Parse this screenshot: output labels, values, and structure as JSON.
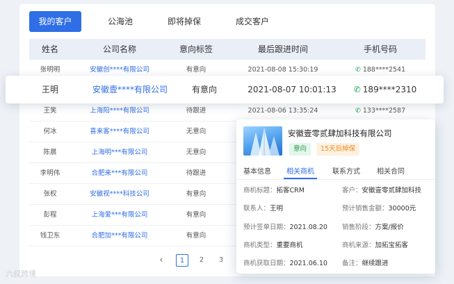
{
  "tabs": [
    "我的客户",
    "公海池",
    "即将掉保",
    "成交客户"
  ],
  "columns": [
    "姓名",
    "公司名称",
    "意向标签",
    "最后跟进时间",
    "手机号码"
  ],
  "rows": [
    {
      "name": "张明明",
      "company": "安徽创****有限公司",
      "tag": "有意向",
      "time": "2021-08-08  15:30:19",
      "phone": "188****2541"
    },
    {
      "name": "王明",
      "company": "安徽壹****有限公司",
      "tag": "有意向",
      "time": "2021-08-07  10:01:13",
      "phone": "189****2310"
    },
    {
      "name": "王笑",
      "company": "上海阳****有限公司",
      "tag": "待跟进",
      "time": "2021-08-06  13:35:24",
      "phone": "133****2587"
    },
    {
      "name": "何冰",
      "company": "喜来客****有限公司",
      "tag": "无意向"
    },
    {
      "name": "陈晨",
      "company": "上海明***有限公司",
      "tag": "无意向"
    },
    {
      "name": "李明伟",
      "company": "合肥来***有限公司",
      "tag": "待跟进"
    },
    {
      "name": "张权",
      "company": "安徽视****科技公司",
      "tag": "有意向"
    },
    {
      "name": "彭程",
      "company": "上海爱***有限公司",
      "tag": "有意向"
    },
    {
      "name": "钱卫东",
      "company": "合肥加***有限公司",
      "tag": "有意向"
    }
  ],
  "pagination": {
    "pages": [
      "1",
      "2",
      "3"
    ],
    "current": "1",
    "prev": "‹"
  },
  "icons": {
    "phone": "phone-icon",
    "prev": "chevron-left-icon"
  },
  "popup": {
    "company": "安徽壹零贰肆加科技有限公司",
    "tags": [
      "意向",
      "15天后掉保"
    ],
    "tabs": [
      "基本信息",
      "相关商机",
      "联系方式",
      "相关合同"
    ],
    "active_tab": "相关商机",
    "fields": {
      "opportunity_title_label": "商机标题：",
      "opportunity_title": "拓客CRM",
      "customer_label": "客户：",
      "customer": "安徽壹零贰肆加科技",
      "contact_label": "联系人：",
      "contact": "王明",
      "expected_amount_label": "预计销售金额：",
      "expected_amount": "30000元",
      "sign_date_label": "预计签单日期：",
      "sign_date": "2021.08.20",
      "stage_label": "销售阶段：",
      "stage": "方案/报价",
      "type_label": "商机类型：",
      "type": "重要商机",
      "source_label": "商机来源：",
      "source": "加拓宝拓客",
      "acquire_date_label": "商机获取日期：",
      "acquire_date": "2021.06.10",
      "remark_label": "备注：",
      "remark": "继续跟进"
    }
  },
  "watermark": "六叔跨境",
  "colors": {
    "accent": "#2f6ee6",
    "phone": "#1aa058",
    "tag_green": "#2a9a57",
    "tag_orange": "#f08a24"
  }
}
